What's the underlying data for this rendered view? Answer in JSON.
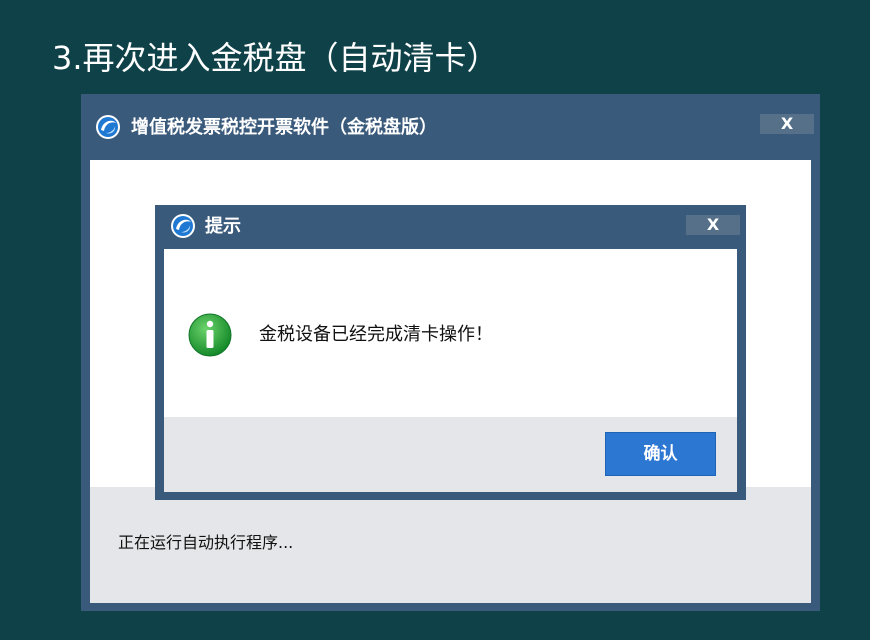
{
  "slide": {
    "title": "3.再次进入金税盘（自动清卡）"
  },
  "app_window": {
    "title": "增值税发票税控开票软件（金税盘版）",
    "close_label": "X",
    "status_text": "正在运行自动执行程序..."
  },
  "dialog": {
    "title": "提示",
    "close_label": "X",
    "message": "金税设备已经完成清卡操作！",
    "ok_label": "确认"
  },
  "colors": {
    "background": "#0f4148",
    "titlebar": "#3a5a7b",
    "button_blue": "#2c77d2",
    "info_green": "#2a9a3a"
  },
  "icons": [
    "app-logo-icon",
    "close-icon",
    "info-icon"
  ]
}
